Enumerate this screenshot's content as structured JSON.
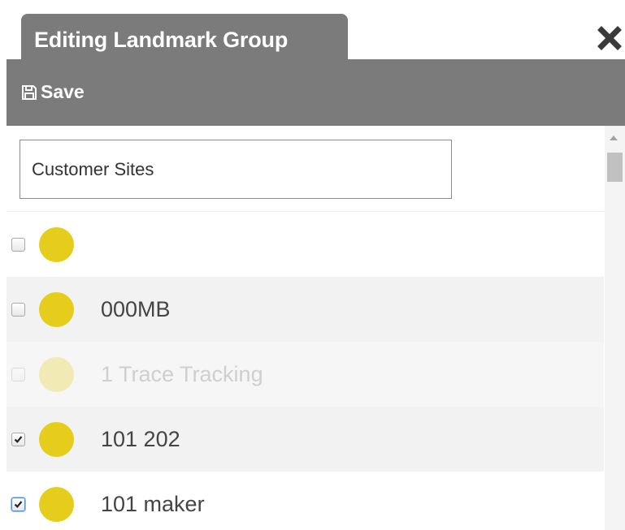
{
  "header": {
    "tab_title": "Editing Landmark Group",
    "close_icon": "close-icon"
  },
  "toolbar": {
    "save_label": "Save",
    "save_icon": "floppy-disk-icon"
  },
  "form": {
    "group_name_value": "Customer Sites"
  },
  "landmarks": [
    {
      "label": "",
      "checked": false,
      "disabled": false,
      "color": "#e6cd1c"
    },
    {
      "label": "000MB",
      "checked": false,
      "disabled": false,
      "color": "#e6cd1c"
    },
    {
      "label": "1 Trace Tracking",
      "checked": false,
      "disabled": true,
      "color": "#e6cd1c"
    },
    {
      "label": "101 202",
      "checked": true,
      "disabled": false,
      "color": "#e6cd1c"
    },
    {
      "label": "101 maker",
      "checked": true,
      "disabled": false,
      "color": "#e6cd1c",
      "focused": true
    }
  ],
  "colors": {
    "header_bg": "#7b7b7b",
    "header_text": "#ffffff",
    "dot_yellow": "#e6cd1c",
    "row_alt": "#f2f2f2"
  }
}
